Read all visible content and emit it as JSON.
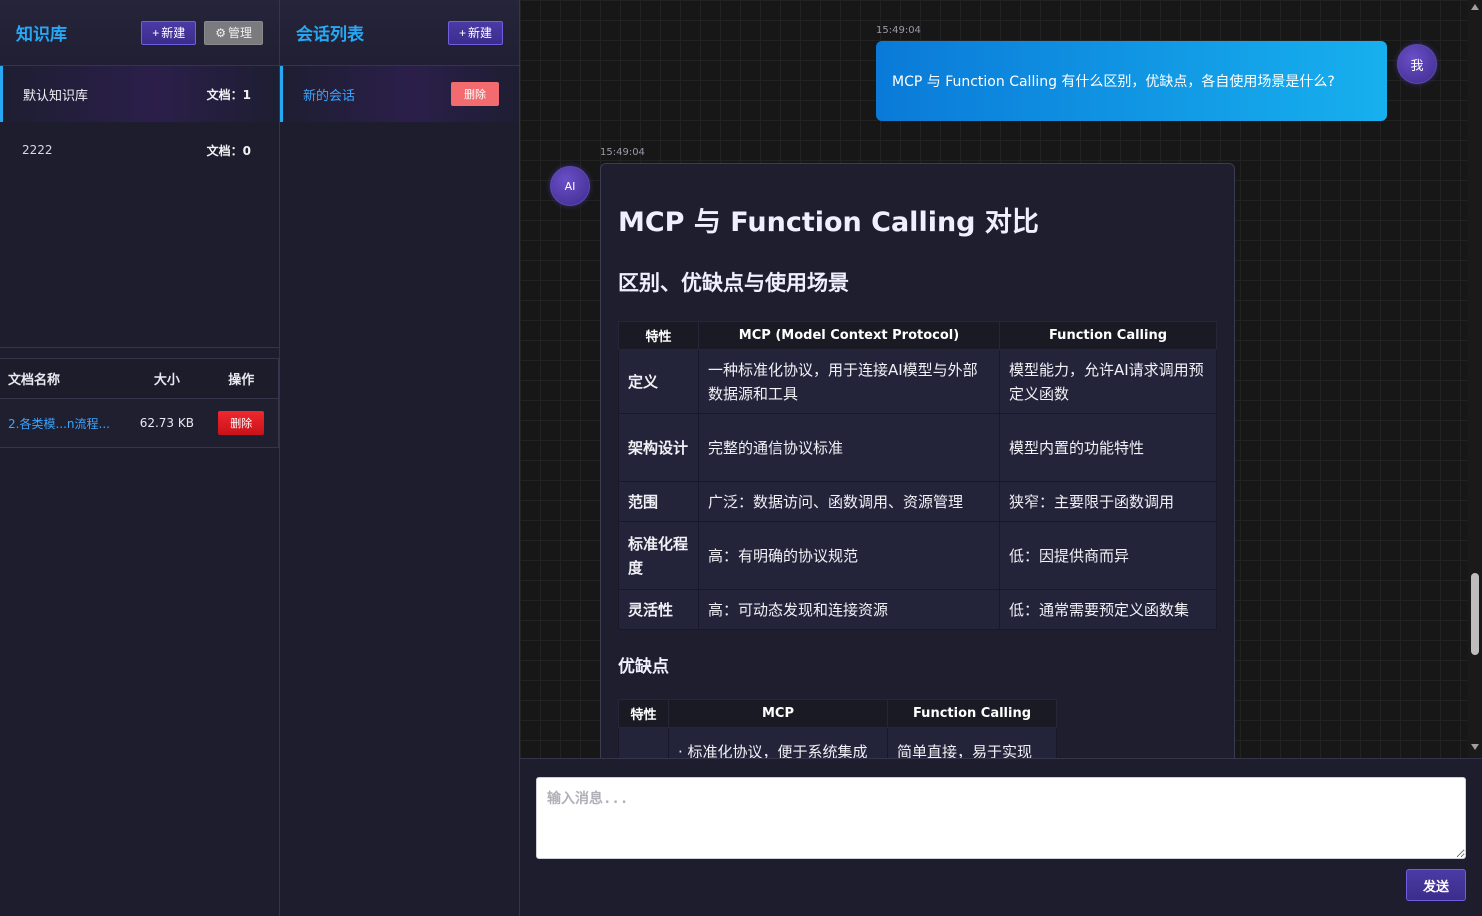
{
  "knowledge_base": {
    "title": "知识库",
    "new_label": "新建",
    "manage_label": "管理",
    "items": [
      {
        "name": "默认知识库",
        "count": "文档：1"
      },
      {
        "name": "2222",
        "count": "文档：0"
      }
    ],
    "documents": {
      "headers": [
        "文档名称",
        "大小",
        "操作"
      ],
      "rows": [
        {
          "name": "2.各类模...n流程...",
          "size": "62.73 KB",
          "action": "删除"
        }
      ]
    }
  },
  "conversations": {
    "title": "会话列表",
    "new_label": "新建",
    "items": [
      {
        "title": "新的会话",
        "delete_label": "删除"
      }
    ]
  },
  "chat": {
    "user_message": {
      "time": "15:49:04",
      "avatar": "我",
      "text": "MCP 与 Function Calling 有什么区别，优缺点，各自使用场景是什么?"
    },
    "ai_message": {
      "time": "15:49:04",
      "avatar": "AI",
      "h1": "MCP 与 Function Calling 对比",
      "h2": "区别、优缺点与使用场景",
      "table1": {
        "headers": [
          "特性",
          "MCP (Model Context Protocol)",
          "Function Calling"
        ],
        "rows": [
          [
            "定义",
            "一种标准化协议，用于连接AI模型与外部数据源和工具",
            "模型能力，允许AI请求调用预定义函数"
          ],
          [
            "架构设计",
            "完整的通信协议标准",
            "模型内置的功能特性"
          ],
          [
            "范围",
            "广泛：数据访问、函数调用、资源管理",
            "狭窄：主要限于函数调用"
          ],
          [
            "标准化程度",
            "高：有明确的协议规范",
            "低：因提供商而异"
          ],
          [
            "灵活性",
            "高：可动态发现和连接资源",
            "低：通常需要预定义函数集"
          ]
        ]
      },
      "h3": "优缺点",
      "table2": {
        "headers": [
          "特性",
          "MCP",
          "Function Calling"
        ],
        "rows": [
          [
            "",
            "· 标准化协议，便于系统集成",
            "简单直接，易于实现"
          ]
        ]
      }
    },
    "input_placeholder": "输入消息...",
    "send_label": "发送"
  }
}
